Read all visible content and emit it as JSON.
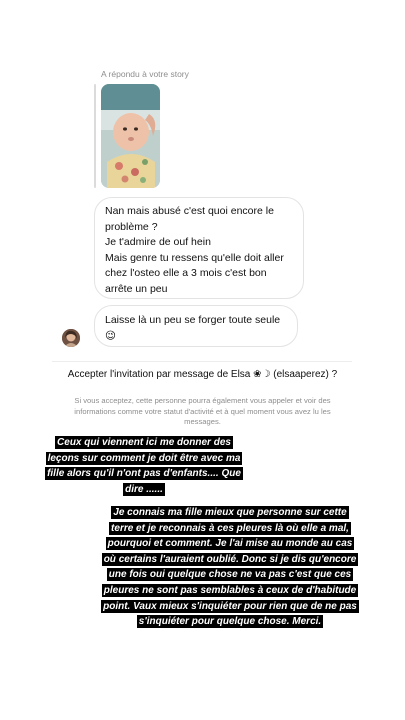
{
  "story_reply": {
    "label": "A répondu à votre story",
    "thumbnail_icon": "baby-photo-thumbnail"
  },
  "messages": [
    {
      "lines": [
        "Nan mais abusé c'est quoi encore le problème ?",
        "Je t'admire de ouf hein",
        "Mais genre tu ressens qu'elle doit aller chez l'osteo elle a 3 mois c'est bon arrête un peu"
      ]
    },
    {
      "lines": [
        "Laisse là un peu se forger toute seule 😉"
      ]
    }
  ],
  "avatar_icon": "user-avatar",
  "invitation": {
    "title": "Accepter l'invitation par message de Elsa ❀☽ (elsaaperez) ?",
    "description": "Si vous acceptez, cette personne pourra également vous appeler et voir des informations comme votre statut d'activité et à quel moment vous avez lu les messages."
  },
  "overlay": {
    "text1": "Ceux qui viennent ici me donner des leçons sur comment je doit être avec ma fille alors qu'il n'ont pas d'enfants.... Que dire ......",
    "text2": "Je connais ma fille mieux que personne sur cette terre et je reconnais à ces pleures là où elle a mal, pourquoi et comment. Je l'ai mise au monde au cas où certains l'auraient oublié. Donc si je dis qu'encore une fois oui quelque chose ne va pas c'est que ces pleures ne sont pas semblables à ceux de d'habitude point. Vaux mieux s'inquiéter pour rien que de ne pas s'inquiéter pour quelque chose. Merci."
  }
}
